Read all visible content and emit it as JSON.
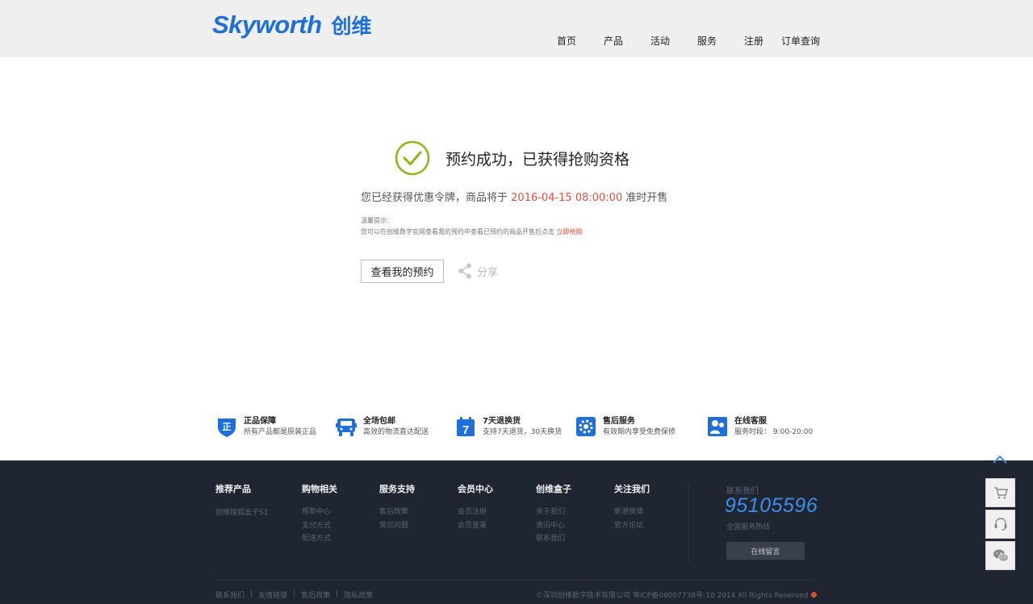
{
  "header": {
    "logo_en": "Skyworth",
    "logo_cn": "创维",
    "nav": [
      {
        "label": "首页"
      },
      {
        "label": "产品"
      },
      {
        "label": "活动"
      },
      {
        "label": "服务"
      },
      {
        "label": "注册"
      },
      {
        "label": "订单查询"
      }
    ]
  },
  "main": {
    "title": "预约成功，已获得抢购资格",
    "info_prefix": "您已经获得优惠令牌，商品将于",
    "info_time": "2016-04-15 08:00:00",
    "info_suffix": "准时开售",
    "tip_label": "温馨提示：",
    "tip_text": "您可以在创维数字官网查看我的预约中查看已预约的商品开售后点击",
    "tip_link": "立即抢购",
    "view_button": "查看我的预约",
    "share_label": "分享"
  },
  "services": [
    {
      "title": "正品保障",
      "desc": "所有产品都是原装正品",
      "icon": "shield-icon"
    },
    {
      "title": "全场包邮",
      "desc": "高效的物流直达配送",
      "icon": "truck-icon"
    },
    {
      "title": "7天退换货",
      "desc": "支持7天退货，30天换货",
      "icon": "calendar-icon"
    },
    {
      "title": "售后服务",
      "desc": "有效期内享受免费保修",
      "icon": "gear-icon"
    },
    {
      "title": "在线客服",
      "desc": "服务时段：  9:00-20:00",
      "icon": "customer-service-icon"
    }
  ],
  "footer": {
    "columns": [
      {
        "title": "推荐产品",
        "links": [
          "创维搜狐盒子S1"
        ]
      },
      {
        "title": "购物相关",
        "links": [
          "帮助中心",
          "支付方式",
          "配送方式"
        ]
      },
      {
        "title": "服务支持",
        "links": [
          "售后政策",
          "常见问题"
        ]
      },
      {
        "title": "会员中心",
        "links": [
          "会员注册",
          "会员登录"
        ]
      },
      {
        "title": "创维盒子",
        "links": [
          "关于我们",
          "资讯中心",
          "联系我们"
        ]
      },
      {
        "title": "关注我们",
        "links": [
          "新浪微博",
          "官方论坛"
        ]
      }
    ],
    "contact_label": "联系我们",
    "phone": "95105596",
    "phone_sub": "全国服务热线",
    "message_button": "在线留言",
    "bottom_links": [
      "联系我们",
      "友情链接",
      "售后政策",
      "隐私政策"
    ],
    "copyright": "©深圳创维数字技术有限公司 粤ICP备08007738号-10 2014 All Rights Reserved"
  },
  "colors": {
    "brand": "#1e6fd9",
    "success": "#8cb81b",
    "highlight": "#e84c3d",
    "footer_bg": "#1f2631"
  }
}
